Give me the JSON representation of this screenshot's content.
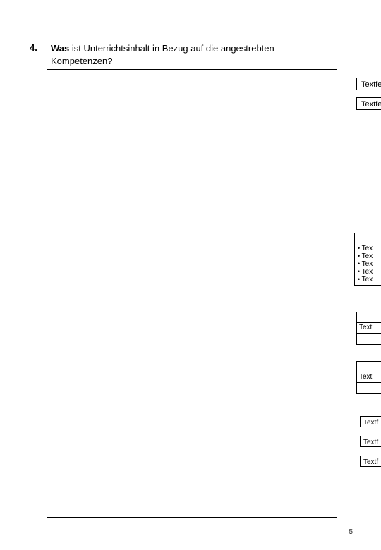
{
  "heading": {
    "number": "4.",
    "bold_word": "Was",
    "rest": " ist Unterrichtsinhalt in Bezug auf die angestrebten Kompetenzen?"
  },
  "sideA": {
    "items": [
      "Textfel",
      "Textfel"
    ]
  },
  "sideB": {
    "items": [
      "Tex",
      "Tex",
      "Tex",
      "Tex",
      "Tex"
    ]
  },
  "tri1": {
    "r1": "",
    "r2": "Text",
    "r3": ""
  },
  "tri2": {
    "r1": "",
    "r2": "Text",
    "r3": ""
  },
  "sideC": {
    "items": [
      "Textf",
      "Textf",
      "Textf"
    ]
  },
  "page_number": "5"
}
